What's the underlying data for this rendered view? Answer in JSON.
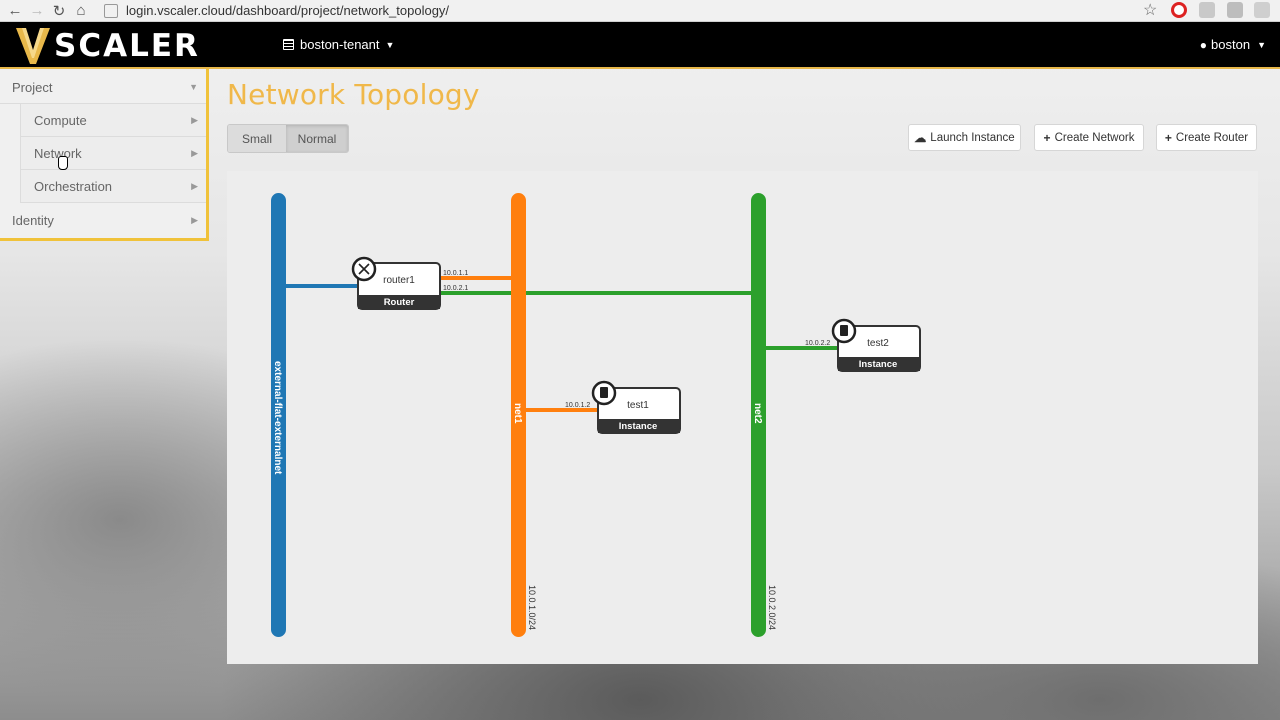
{
  "browser": {
    "url": "login.vscaler.cloud/dashboard/project/network_topology/"
  },
  "header": {
    "logo_text": "SCALER",
    "tenant": "boston-tenant",
    "user": "boston"
  },
  "sidebar": {
    "project": "Project",
    "items": [
      {
        "label": "Compute"
      },
      {
        "label": "Network"
      },
      {
        "label": "Orchestration"
      }
    ],
    "identity": "Identity"
  },
  "main": {
    "title": "Network Topology",
    "size_small": "Small",
    "size_normal": "Normal",
    "launch_instance": "Launch Instance",
    "create_network": "Create Network",
    "create_router": "Create Router"
  },
  "topology": {
    "networks": [
      {
        "name": "external-flat-externalnet",
        "color": "#1f77b4",
        "cidr": ""
      },
      {
        "name": "net1",
        "color": "#ff7f0e",
        "cidr": "10.0.1.0/24"
      },
      {
        "name": "net2",
        "color": "#2ca02c",
        "cidr": "10.0.2.0/24"
      }
    ],
    "router": {
      "name": "router1",
      "type": "Router",
      "ips": [
        "10.0.1.1",
        "10.0.2.1"
      ]
    },
    "instances": [
      {
        "name": "test1",
        "type": "Instance",
        "ip": "10.0.1.2"
      },
      {
        "name": "test2",
        "type": "Instance",
        "ip": "10.0.2.2"
      }
    ]
  },
  "icons": [
    "back-arrow-icon",
    "forward-arrow-icon",
    "reload-icon",
    "home-icon",
    "star-icon",
    "tenant-icon",
    "user-icon",
    "caret-down-icon",
    "upload-icon",
    "plus-icon",
    "router-icon",
    "server-icon"
  ]
}
